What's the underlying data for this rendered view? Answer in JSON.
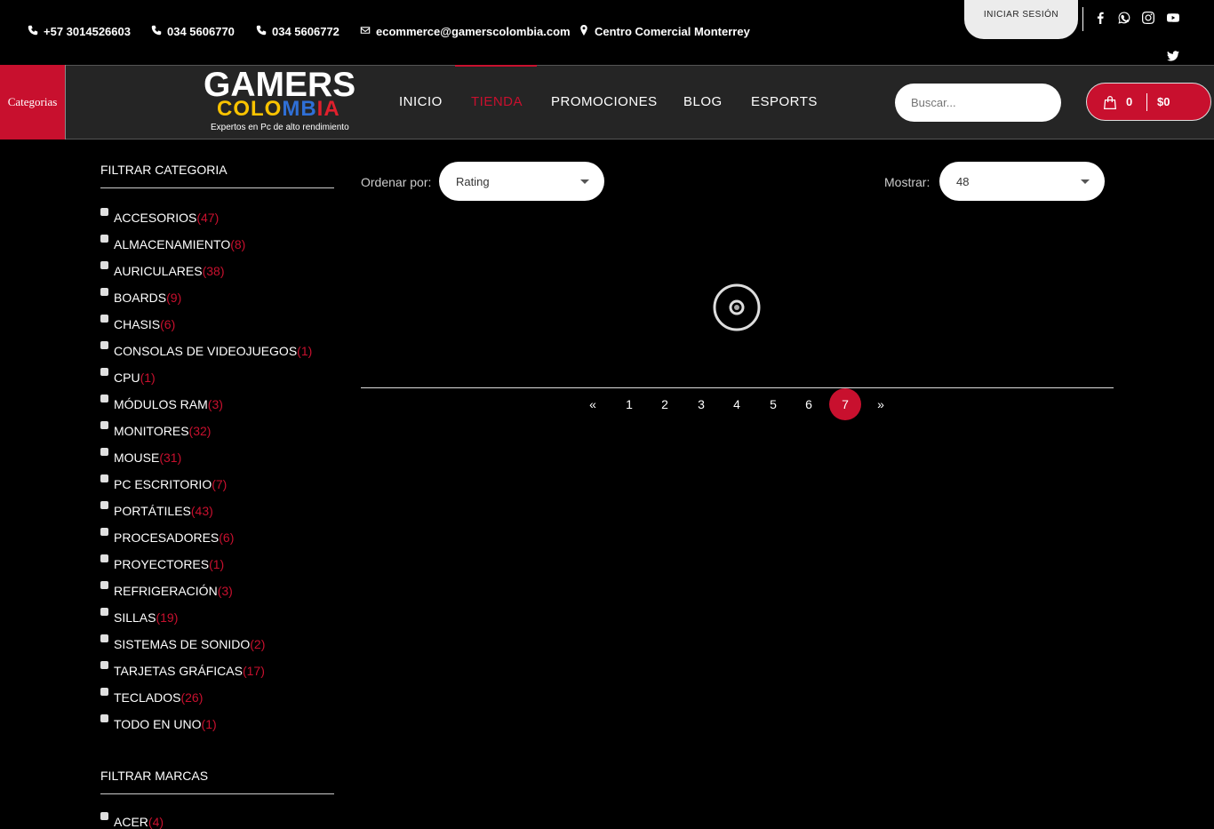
{
  "topbar": {
    "contacts": [
      {
        "icon": "phone-icon",
        "text": "+57 3014526603"
      },
      {
        "icon": "phone-icon",
        "text": "034 5606770"
      },
      {
        "icon": "phone-icon",
        "text": "034 5606772"
      },
      {
        "icon": "envelope-icon",
        "text": "ecommerce@gamerscolombia.com"
      },
      {
        "icon": "map-marker-icon",
        "text": "Centro Comercial Monterrey"
      }
    ],
    "login_label": "INICIAR SESIÓN",
    "social": [
      "facebook-icon",
      "whatsapp-icon",
      "instagram-icon",
      "youtube-icon",
      "twitter-icon"
    ]
  },
  "header": {
    "categories_label": "Categorias",
    "logo": {
      "line1": "GAMERS",
      "line2": "COLOMBIA",
      "tagline": "Expertos en Pc de alto rendimiento"
    },
    "nav": [
      {
        "label": "INICIO",
        "active": false
      },
      {
        "label": "TIENDA",
        "active": true
      },
      {
        "label": "PROMOCIONES",
        "active": false
      },
      {
        "label": "BLOG",
        "active": false
      },
      {
        "label": "ESPORTS",
        "active": false
      }
    ],
    "search_placeholder": "Buscar...",
    "cart": {
      "count": "0",
      "total": "$0"
    }
  },
  "sidebar": {
    "category_title": "FILTRAR CATEGORIA",
    "categories": [
      {
        "name": "ACCESORIOS",
        "count": "(47)"
      },
      {
        "name": "ALMACENAMIENTO",
        "count": "(8)"
      },
      {
        "name": "AURICULARES",
        "count": "(38)"
      },
      {
        "name": "BOARDS",
        "count": "(9)"
      },
      {
        "name": "CHASIS",
        "count": "(6)"
      },
      {
        "name": "CONSOLAS DE VIDEOJUEGOS",
        "count": "(1)"
      },
      {
        "name": "CPU",
        "count": "(1)"
      },
      {
        "name": "MÓDULOS RAM",
        "count": "(3)"
      },
      {
        "name": "MONITORES",
        "count": "(32)"
      },
      {
        "name": "MOUSE",
        "count": "(31)"
      },
      {
        "name": "PC ESCRITORIO",
        "count": "(7)"
      },
      {
        "name": "PORTÁTILES",
        "count": "(43)"
      },
      {
        "name": "PROCESADORES",
        "count": "(6)"
      },
      {
        "name": "PROYECTORES",
        "count": "(1)"
      },
      {
        "name": "REFRIGERACIÓN",
        "count": "(3)"
      },
      {
        "name": "SILLAS",
        "count": "(19)"
      },
      {
        "name": "SISTEMAS DE SONIDO",
        "count": "(2)"
      },
      {
        "name": "TARJETAS GRÁFICAS",
        "count": "(17)"
      },
      {
        "name": "TECLADOS",
        "count": "(26)"
      },
      {
        "name": "TODO EN UNO",
        "count": "(1)"
      }
    ],
    "brand_title": "FILTRAR MARCAS",
    "brands": [
      {
        "name": "ACER",
        "count": "(4)"
      }
    ]
  },
  "toolbar": {
    "sort_label": "Ordenar por:",
    "sort_value": "Rating",
    "show_label": "Mostrar:",
    "show_value": "48"
  },
  "pagination": {
    "prev": "«",
    "pages": [
      "1",
      "2",
      "3",
      "4",
      "5",
      "6",
      "7"
    ],
    "current": "7",
    "next": "»"
  },
  "colors": {
    "accent": "#c8102e",
    "background": "#000000",
    "navbar": "#252525"
  }
}
